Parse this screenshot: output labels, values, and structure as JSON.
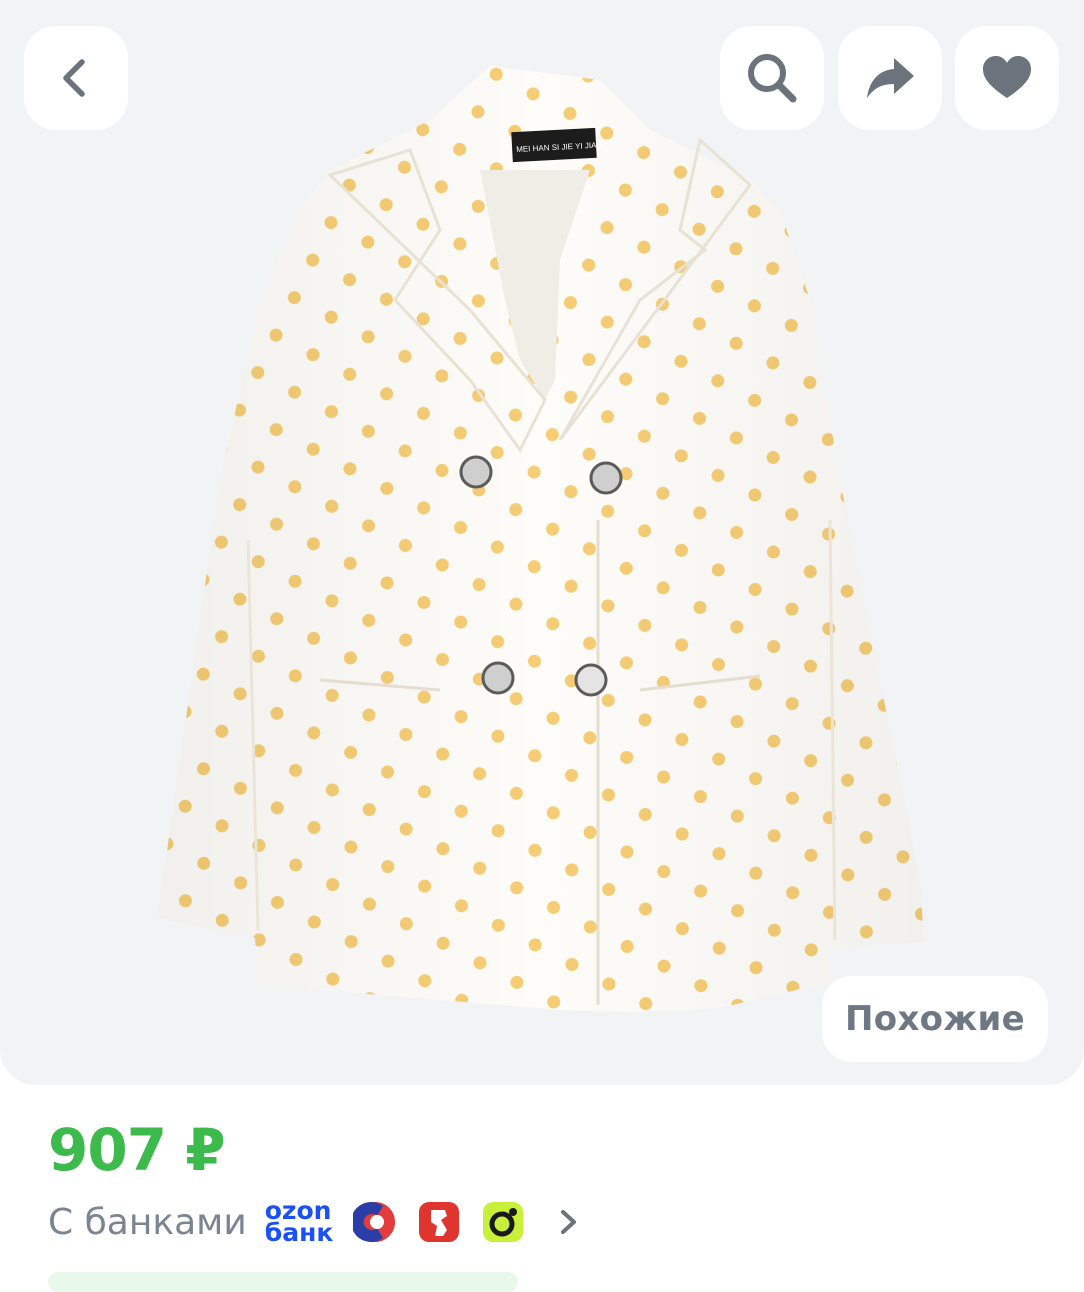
{
  "toolbar": {
    "back_icon": "chevron-left-icon",
    "search_icon": "search-icon",
    "share_icon": "share-arrow-icon",
    "favorite_icon": "heart-icon"
  },
  "gallery": {
    "similar_label": "Похожие",
    "label_on_tag": "MEI HAN SI JIE YI JIAO",
    "background_color": "#f2f3f5",
    "dot_color": "#f6cd75"
  },
  "price": {
    "value": "907 ₽",
    "color": "#3dba4c"
  },
  "banks": {
    "label": "С банками",
    "ozon_line1": "ozon",
    "ozon_line2": "банк",
    "logos": [
      "ozon-bank-logo",
      "bank-logo-blue-red",
      "bank-logo-red-knight",
      "bank-logo-green"
    ]
  }
}
